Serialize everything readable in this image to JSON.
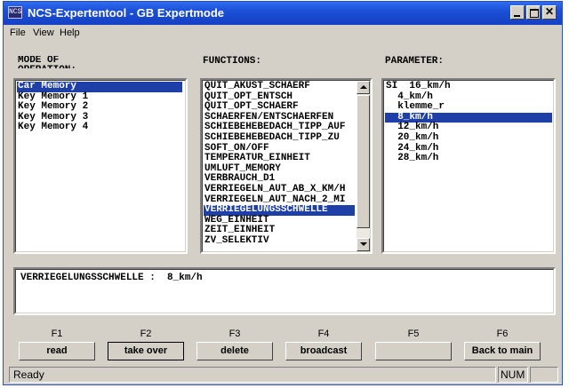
{
  "window": {
    "title": "NCS-Expertentool - GB Expertmode",
    "icon_text": "NCS"
  },
  "menu": [
    "File",
    "View",
    "Help"
  ],
  "headings": {
    "mode": "MODE OF OPERATION:",
    "functions": "FUNCTIONS:",
    "parameter": "PARAMETER:"
  },
  "modes": [
    "Car Memory",
    "Key Memory 1",
    "Key Memory 2",
    "Key Memory 3",
    "Key Memory 4"
  ],
  "modes_selected": 0,
  "functions": [
    "QUIT_AKUST_SCHAERF",
    "QUIT_OPT_ENTSCH",
    "QUIT_OPT_SCHAERF",
    "SCHAERFEN/ENTSCHAERFEN",
    "SCHIEBEHEBEDACH_TIPP_AUF",
    "SCHIEBEHEBEDACH_TIPP_ZU",
    "SOFT_ON/OFF",
    "TEMPERATUR_EINHEIT",
    "UMLUFT_MEMORY",
    "VERBRAUCH_D1",
    "VERRIEGELN_AUT_AB_X_KM/H",
    "VERRIEGELN_AUT_NACH_2_MI",
    "VERRIEGELUNGSSCHWELLE",
    "WEG_EINHEIT",
    "ZEIT_EINHEIT",
    "ZV_SELEKTIV"
  ],
  "functions_selected": 12,
  "parameters": [
    "SI  16_km/h",
    "  4_km/h",
    "  klemme_r",
    "  8_km/h",
    "  12_km/h",
    "  20_km/h",
    "  24_km/h",
    "  28_km/h"
  ],
  "parameters_selected": 3,
  "detail": {
    "text": "VERRIEGELUNGSSCHWELLE :  8_km/h"
  },
  "fkeys": [
    "F1",
    "F2",
    "F3",
    "F4",
    "F5",
    "F6"
  ],
  "buttons": {
    "read": "read",
    "take_over": "take over",
    "delete": "delete",
    "broadcast": "broadcast",
    "f5": "",
    "back": "Back to main"
  },
  "statusbar": {
    "text": "Ready",
    "num": "NUM"
  }
}
